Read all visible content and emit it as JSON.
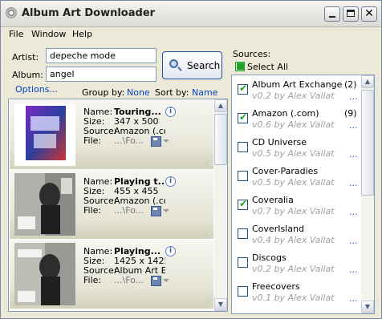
{
  "window": {
    "title": "Album Art Downloader"
  },
  "menu": {
    "file": "File",
    "window": "Window",
    "help": "Help"
  },
  "search": {
    "artist_label": "Artist:",
    "artist_value": "depeche mode",
    "album_label": "Album:",
    "album_value": "angel",
    "button_label": "Search",
    "options_link": "Options..."
  },
  "sorting": {
    "group_label": "Group by:",
    "group_value": "None",
    "sort_label": "Sort by:",
    "sort_value": "Name"
  },
  "results": {
    "field_labels": {
      "name": "Name:",
      "size": "Size:",
      "source": "Source:",
      "file": "File:"
    },
    "items": [
      {
        "name": "Touring...",
        "size": "347 x 500",
        "source": "Amazon (.co...",
        "file": "...\\Fo...",
        "name_bold": true
      },
      {
        "name": "Playing t...",
        "size": "455 x 455",
        "source": "Amazon (.co...",
        "file": "...\\Fo...",
        "name_bold": false
      },
      {
        "name": "Playing...",
        "size": "1425 x 1425",
        "source": "Album Art Ex...",
        "file": "...\\Fo...",
        "name_bold": true
      }
    ]
  },
  "sources_panel": {
    "label": "Sources:",
    "select_all": "Select All",
    "items": [
      {
        "name": "Album Art Exchange",
        "version": "v0.2 by Alex Vallat",
        "count": "(2)",
        "checked": true
      },
      {
        "name": "Amazon (.com)",
        "version": "v0.6 by Alex Vallat",
        "count": "(9)",
        "checked": true
      },
      {
        "name": "CD Universe",
        "version": "v0.5 by Alex Vallat",
        "count": "",
        "checked": false
      },
      {
        "name": "Cover-Paradies",
        "version": "v0.5 by Alex Vallat",
        "count": "",
        "checked": false
      },
      {
        "name": "Coveralia",
        "version": "v0.7 by Alex Vallat",
        "count": "",
        "checked": true
      },
      {
        "name": "CoverIsland",
        "version": "v0.4 by Alex Vallat",
        "count": "",
        "checked": false
      },
      {
        "name": "Discogs",
        "version": "v0.2 by Alex Vallat",
        "count": "",
        "checked": false
      },
      {
        "name": "Freecovers",
        "version": "v0.1 by Alex Vallat",
        "count": "",
        "checked": false
      }
    ],
    "more_label": "..."
  },
  "colors": {
    "accent": "#0044cc",
    "check": "#21a121"
  }
}
